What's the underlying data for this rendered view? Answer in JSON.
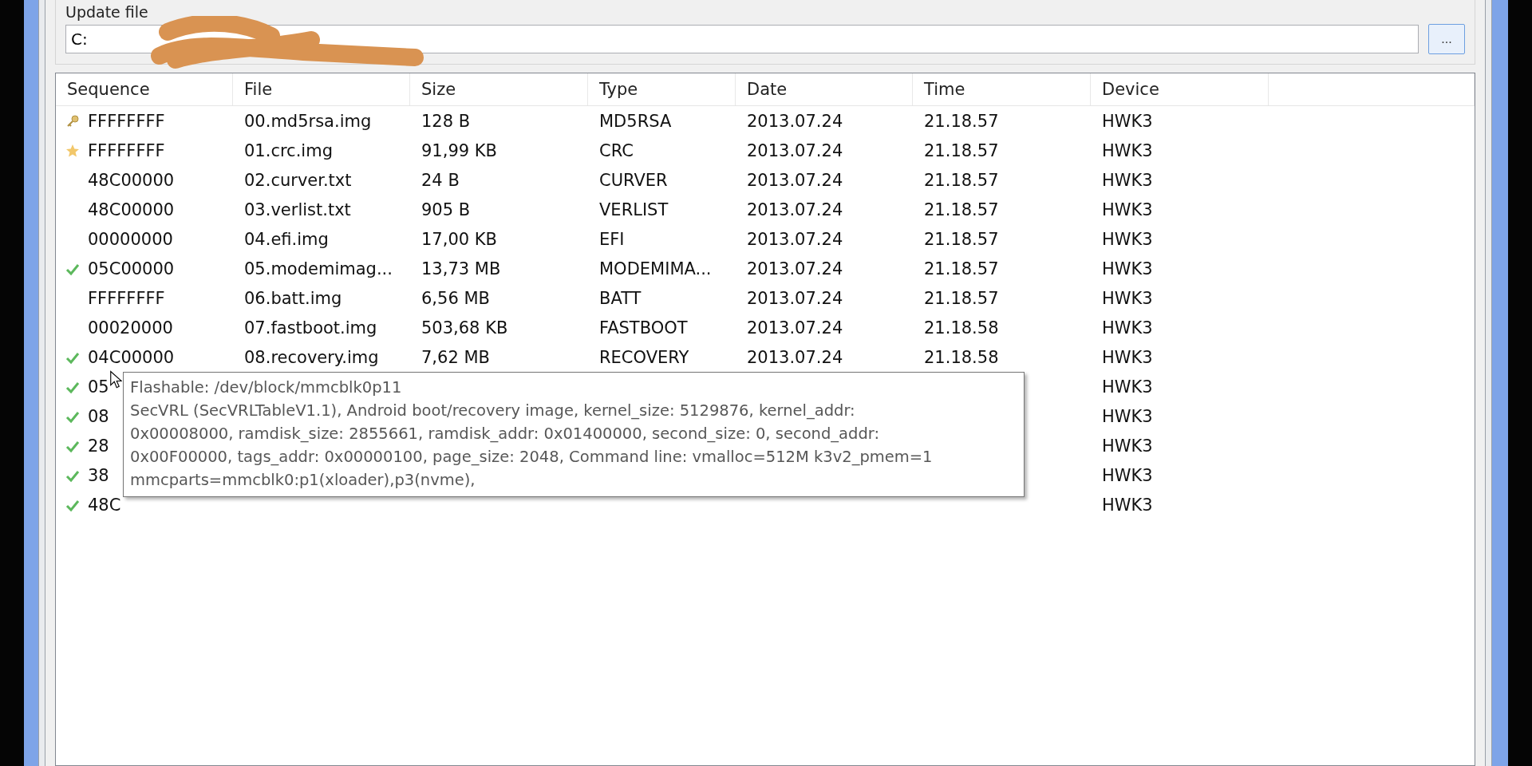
{
  "update_file": {
    "label": "Update file",
    "value": "C:",
    "browse_button": "..."
  },
  "table": {
    "columns": [
      "Sequence",
      "File",
      "Size",
      "Type",
      "Date",
      "Time",
      "Device"
    ],
    "rows": [
      {
        "kind": "key",
        "cells": [
          "FFFFFFFF",
          "00.md5rsa.img",
          "128 B",
          "MD5RSA",
          "2013.07.24",
          "21.18.57",
          "HWK3"
        ]
      },
      {
        "kind": "star",
        "cells": [
          "FFFFFFFF",
          "01.crc.img",
          "91,99 KB",
          "CRC",
          "2013.07.24",
          "21.18.57",
          "HWK3"
        ]
      },
      {
        "kind": "plain",
        "cells": [
          "48C00000",
          "02.curver.txt",
          "24 B",
          "CURVER",
          "2013.07.24",
          "21.18.57",
          "HWK3"
        ]
      },
      {
        "kind": "plain",
        "cells": [
          "48C00000",
          "03.verlist.txt",
          "905 B",
          "VERLIST",
          "2013.07.24",
          "21.18.57",
          "HWK3"
        ]
      },
      {
        "kind": "plain",
        "cells": [
          "00000000",
          "04.efi.img",
          "17,00 KB",
          "EFI",
          "2013.07.24",
          "21.18.57",
          "HWK3"
        ]
      },
      {
        "kind": "check",
        "cells": [
          "05C00000",
          "05.modemimag...",
          "13,73 MB",
          "MODEMIMA...",
          "2013.07.24",
          "21.18.57",
          "HWK3"
        ]
      },
      {
        "kind": "plain",
        "cells": [
          "FFFFFFFF",
          "06.batt.img",
          "6,56 MB",
          "BATT",
          "2013.07.24",
          "21.18.57",
          "HWK3"
        ]
      },
      {
        "kind": "plain",
        "cells": [
          "00020000",
          "07.fastboot.img",
          "503,68 KB",
          "FASTBOOT",
          "2013.07.24",
          "21.18.58",
          "HWK3"
        ]
      },
      {
        "kind": "check",
        "cells": [
          "04C00000",
          "08.recovery.img",
          "7,62 MB",
          "RECOVERY",
          "2013.07.24",
          "21.18.58",
          "HWK3"
        ]
      },
      {
        "kind": "check",
        "cells": [
          "05",
          "",
          "",
          "",
          "",
          "",
          "HWK3"
        ]
      },
      {
        "kind": "check",
        "cells": [
          "08",
          "",
          "",
          "",
          "",
          "",
          "HWK3"
        ]
      },
      {
        "kind": "check",
        "cells": [
          "28",
          "",
          "",
          "",
          "",
          "",
          "HWK3"
        ]
      },
      {
        "kind": "check",
        "cells": [
          "38",
          "",
          "",
          "",
          "",
          "",
          "HWK3"
        ]
      },
      {
        "kind": "check",
        "cells": [
          "48C",
          "",
          "",
          "",
          "",
          "",
          "HWK3"
        ]
      }
    ]
  },
  "tooltip": {
    "lines": [
      "Flashable: /dev/block/mmcblk0p11",
      "SecVRL (SecVRLTableV1.1), Android boot/recovery image, kernel_size: 5129876, kernel_addr:",
      "0x00008000, ramdisk_size: 2855661, ramdisk_addr: 0x01400000, second_size: 0, second_addr:",
      "0x00F00000, tags_addr: 0x00000100, page_size: 2048, Command line: vmalloc=512M k3v2_pmem=1",
      "mmcparts=mmcblk0:p1(xloader),p3(nvme),"
    ]
  }
}
